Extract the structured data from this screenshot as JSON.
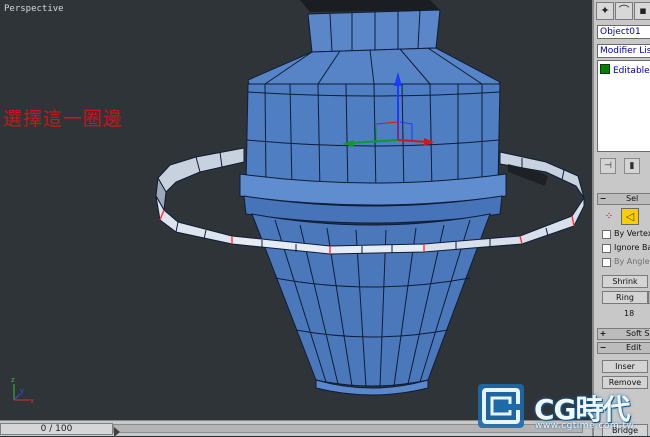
{
  "viewport": {
    "label": "Perspective",
    "annotation": "選擇這一圈邊",
    "colors": {
      "background": "#2f3438",
      "mesh": "#4a75b8",
      "edge": "#0d1e3a",
      "selected_edge": "#ff3030",
      "ring_face": "#cfd8e4"
    }
  },
  "axis_tripod": {
    "x": "x",
    "y": "y",
    "z": "z"
  },
  "timeline": {
    "frame_display": "0 / 100"
  },
  "command_panel": {
    "tabs": [
      "create-tab",
      "modify-tab",
      "hierarchy-tab"
    ],
    "object_name": "Object01",
    "modifier_list": "Modifier List",
    "stack_item": "Editable Po",
    "rollouts": {
      "selection_title": "Sel",
      "soft_selection_title": "Soft S",
      "edit_title": "Edit"
    },
    "options": {
      "by_vertex": "By Vertex",
      "ignore_backfacing": "Ignore Ba",
      "by_angle": "By Angle"
    },
    "buttons": {
      "shrink": "Shrink",
      "ring": "Ring",
      "insert": "Inser",
      "remove": "Remove",
      "bridge": "Bridge"
    },
    "selection_count": "18"
  },
  "watermark": {
    "brand": "CG時代",
    "url": "www.cgtime.com.tw"
  }
}
